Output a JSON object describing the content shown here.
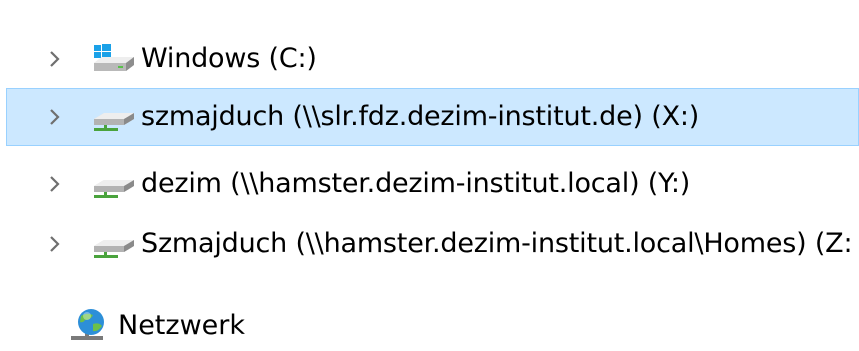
{
  "navigation_pane": {
    "drives": [
      {
        "label": "Windows (C:)",
        "icon": "windows-drive-icon",
        "selected": false
      },
      {
        "label": "szmajduch (\\\\slr.fdz.dezim-institut.de) (X:)",
        "icon": "network-drive-icon",
        "selected": true
      },
      {
        "label": "dezim (\\\\hamster.dezim-institut.local) (Y:)",
        "icon": "network-drive-icon",
        "selected": false
      },
      {
        "label": "Szmajduch (\\\\hamster.dezim-institut.local\\Homes) (Z:",
        "icon": "network-drive-icon",
        "selected": false
      }
    ],
    "network": {
      "label": "Netzwerk",
      "icon": "network-globe-icon"
    }
  },
  "colors": {
    "selection_background": "#cce8ff",
    "selection_border": "#99d1ff",
    "chevron": "#6f6f6f"
  }
}
